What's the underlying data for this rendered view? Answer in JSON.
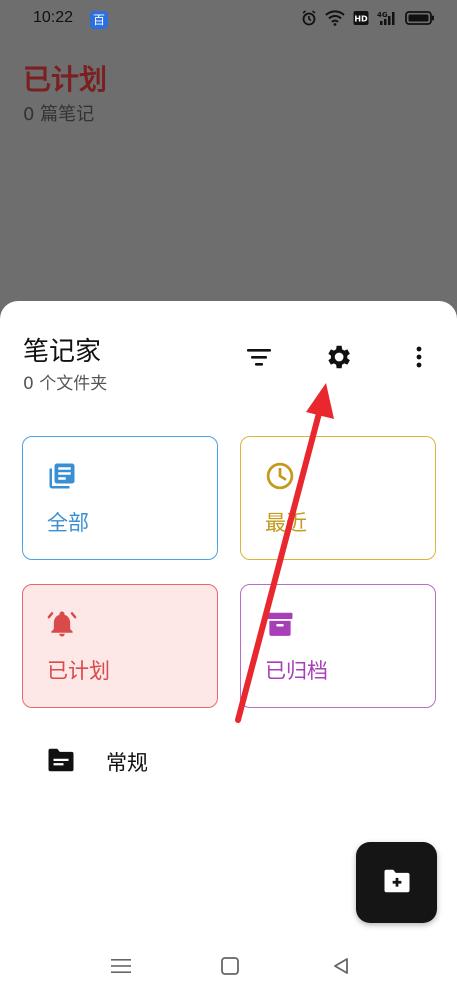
{
  "status_bar": {
    "time": "10:22",
    "app_badge": "百",
    "icons": [
      "alarm-icon",
      "wifi-icon",
      "hd-icon",
      "signal-4g-icon",
      "battery-icon"
    ]
  },
  "background": {
    "title": "已计划",
    "subtitle": "0 篇笔记"
  },
  "sheet": {
    "title": "笔记家",
    "subtitle": "0 个文件夹",
    "toolbar_icons": [
      "filter-icon",
      "gear-icon",
      "more-vertical-icon"
    ]
  },
  "cards": [
    {
      "label": "全部",
      "icon": "notes-stack-icon",
      "color": "#3a8fd2"
    },
    {
      "label": "最近",
      "icon": "clock-icon",
      "color": "#c49a1c"
    },
    {
      "label": "已计划",
      "icon": "bell-icon",
      "color": "#d94a4a"
    },
    {
      "label": "已归档",
      "icon": "archive-box-icon",
      "color": "#a83fb8"
    }
  ],
  "folders": [
    {
      "label": "常规",
      "icon": "folder-icon"
    }
  ],
  "fab": {
    "icon": "new-folder-icon"
  },
  "nav_bar": {
    "icons": [
      "menu-icon",
      "home-square-icon",
      "back-triangle-icon"
    ]
  },
  "annotation": {
    "color": "#e8282e"
  }
}
